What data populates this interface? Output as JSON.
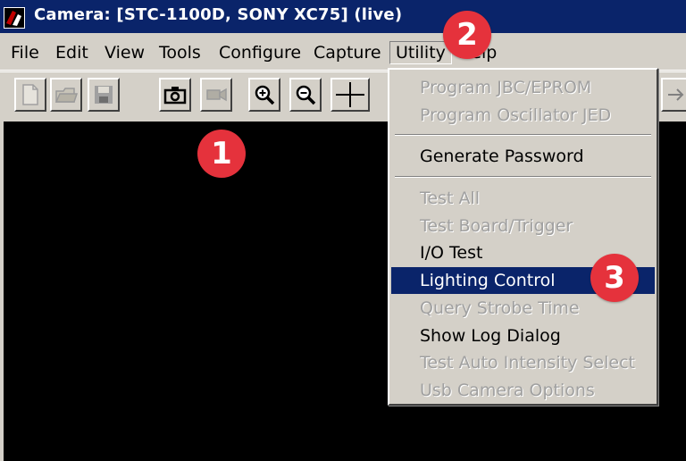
{
  "window": {
    "title": "Camera: [STC-1100D, SONY XC75]  (live)"
  },
  "menubar": [
    {
      "label": "File"
    },
    {
      "label": "Edit"
    },
    {
      "label": "View"
    },
    {
      "label": "Tools"
    },
    {
      "label": "Configure"
    },
    {
      "label": "Capture"
    },
    {
      "label": "Utility",
      "open": true
    },
    {
      "label": "Help"
    }
  ],
  "toolbar": [
    "new-file-icon",
    "open-folder-icon",
    "save-disk-icon",
    "camera-snapshot-icon",
    "video-camera-icon",
    "zoom-in-icon",
    "zoom-out-icon",
    "crosshair-icon"
  ],
  "utility_menu": [
    {
      "label": "Program JBC/EPROM",
      "disabled": true
    },
    {
      "label": "Program Oscillator JED",
      "disabled": true
    },
    {
      "label": "Generate Password",
      "disabled": false
    },
    {
      "label": "Test All",
      "disabled": true
    },
    {
      "label": "Test Board/Trigger",
      "disabled": true
    },
    {
      "label": "I/O Test",
      "disabled": false
    },
    {
      "label": "Lighting Control",
      "disabled": false,
      "selected": true
    },
    {
      "label": "Query Strobe Time",
      "disabled": true
    },
    {
      "label": "Show Log Dialog",
      "disabled": false
    },
    {
      "label": "Test Auto Intensity Select",
      "disabled": true
    },
    {
      "label": "Usb Camera Options",
      "disabled": true
    }
  ],
  "badges": [
    "1",
    "2",
    "3"
  ],
  "colors": {
    "titlebar": "#0a246a",
    "selection": "#0a246a",
    "badge": "#e5323c",
    "chrome": "#d4d0c8"
  }
}
